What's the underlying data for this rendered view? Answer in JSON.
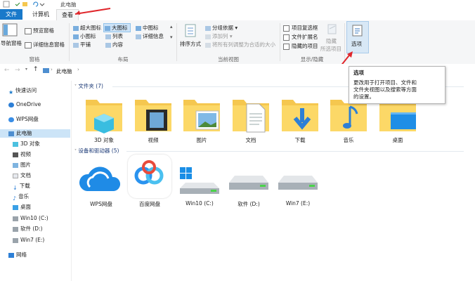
{
  "window": {
    "title": "此电脑"
  },
  "tabs": [
    {
      "label": "文件"
    },
    {
      "label": "计算机"
    },
    {
      "label": "查看"
    }
  ],
  "ribbon": {
    "panes": {
      "nav_pane": "导航窗格",
      "preview_pane": "预览窗格",
      "details_pane": "详细信息窗格",
      "group": "窗格"
    },
    "layout": {
      "extra_large": "超大图标",
      "large": "大图标",
      "medium": "中图标",
      "small": "小图标",
      "list": "列表",
      "details": "详细信息",
      "tiles": "平铺",
      "content": "内容",
      "group": "布局"
    },
    "current_view": {
      "sort_by": "排序方式",
      "group_by": "分组依据",
      "add_columns": "添加列",
      "size_all_columns": "将所有列调整为合适的大小",
      "group": "当前视图"
    },
    "show_hide": {
      "item_checkboxes": "项目复选框",
      "file_extensions": "文件扩展名",
      "hidden_items": "隐藏的项目",
      "hide_selected": "隐藏",
      "hide_selected_2": "所选项目",
      "group": "显示/隐藏"
    },
    "options": {
      "label": "选项"
    }
  },
  "address": {
    "path": "此电脑"
  },
  "tooltip": {
    "title": "选项",
    "lines": [
      "更改用于打开项目、文件和",
      "文件夹视图以及搜索等方面",
      "的设置。"
    ]
  },
  "nav": {
    "quick_access": "快速访问",
    "onedrive": "OneDrive",
    "wps": "WPS网盘",
    "this_pc": "此电脑",
    "children": [
      "3D 对象",
      "视频",
      "图片",
      "文档",
      "下载",
      "音乐",
      "桌面",
      "Win10 (C:)",
      "软件 (D:)",
      "Win7 (E:)"
    ],
    "network": "网络"
  },
  "folders_section": {
    "title": "文件夹 (7)"
  },
  "folders": [
    {
      "label": "3D 对象"
    },
    {
      "label": "视频"
    },
    {
      "label": "图片"
    },
    {
      "label": "文档"
    },
    {
      "label": "下载"
    },
    {
      "label": "音乐"
    },
    {
      "label": "桌面"
    }
  ],
  "devices_section": {
    "title": "设备和驱动器 (5)"
  },
  "devices": [
    {
      "label": "WPS网盘"
    },
    {
      "label": "百度网盘"
    },
    {
      "label": "Win10 (C:)"
    },
    {
      "label": "软件 (D:)"
    },
    {
      "label": "Win7 (E:)"
    }
  ],
  "colors": {
    "accent": "#1979ca",
    "file_tab": "#1979ca",
    "annotation_arrow": "#e0262b",
    "folder": "#f5c74f"
  }
}
